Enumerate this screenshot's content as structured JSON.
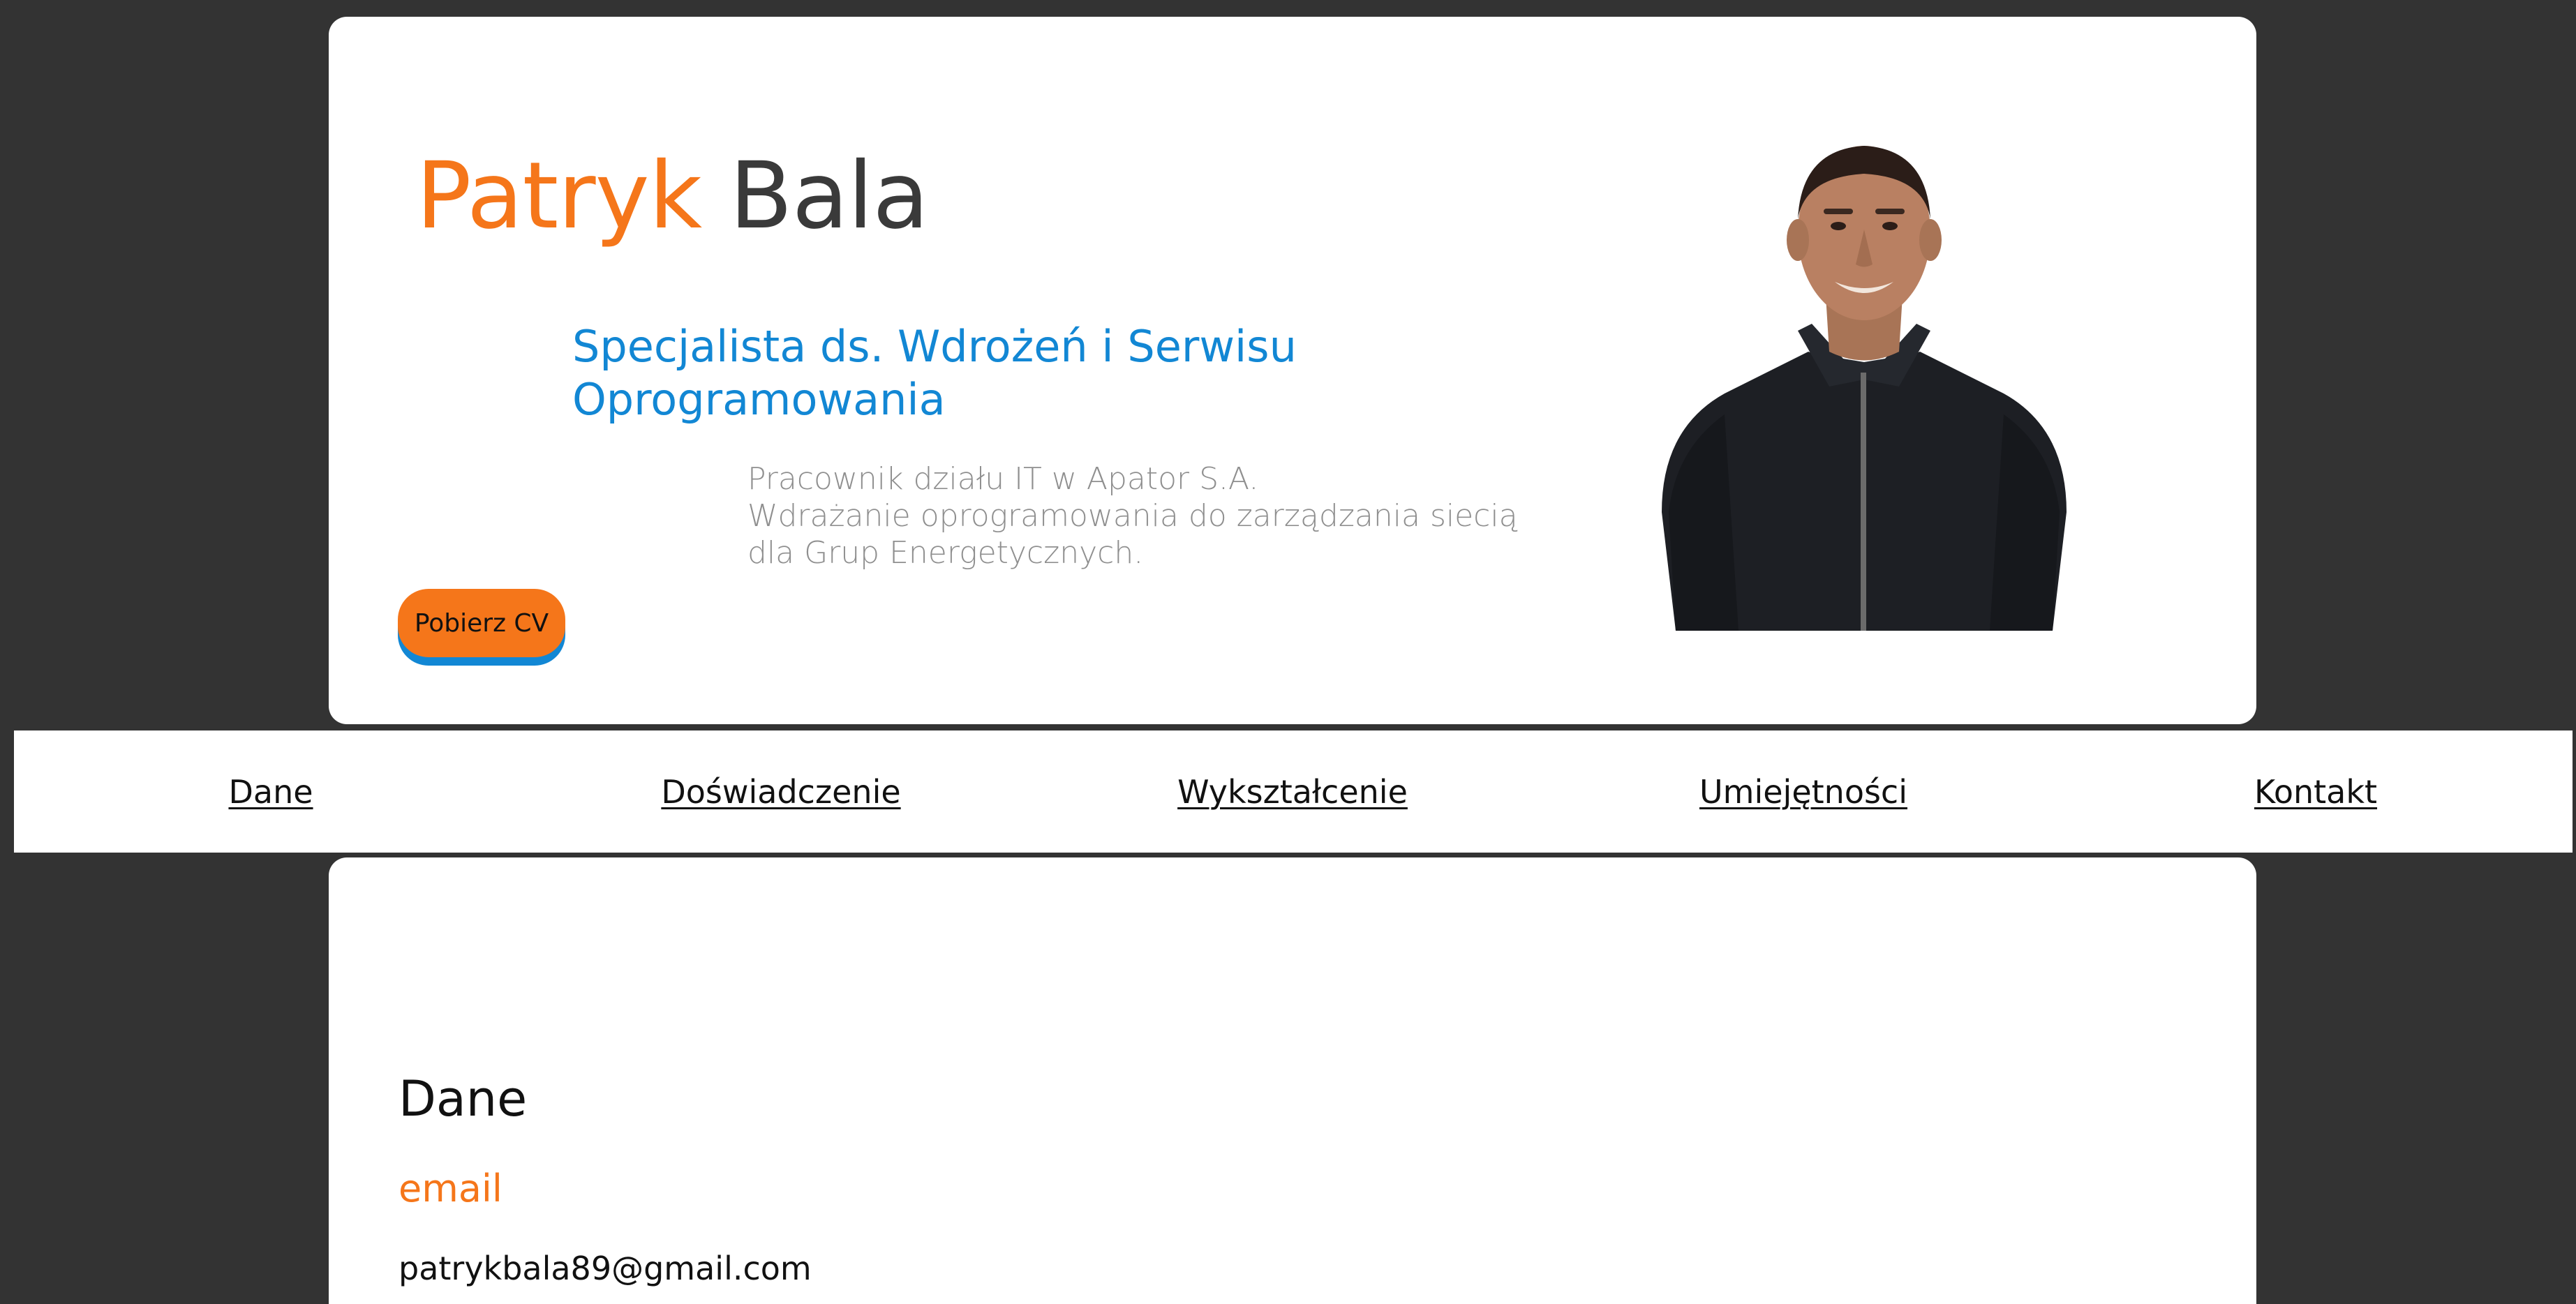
{
  "header": {
    "first_name": "Patryk",
    "last_name": "Bala",
    "job_title_line1": "Specjalista ds. Wdrożeń i Serwisu",
    "job_title_line2": "Oprogramowania",
    "description_line1": "Pracownik działu IT w Apator S.A.",
    "description_line2": "Wdrażanie oprogramowania do zarządzania siecią",
    "description_line3": "dla Grup Energetycznych.",
    "cv_button_label": "Pobierz CV"
  },
  "nav": {
    "items": [
      {
        "label": "Dane"
      },
      {
        "label": "Doświadczenie"
      },
      {
        "label": "Wykształcenie"
      },
      {
        "label": "Umiejętności"
      },
      {
        "label": "Kontakt"
      }
    ]
  },
  "main": {
    "section_title": "Dane",
    "email_label": "email",
    "email_value": "patrykbala89@gmail.com"
  },
  "colors": {
    "background": "#333333",
    "card": "#ffffff",
    "accent_orange": "#f5761a",
    "accent_blue": "#1287d4",
    "name_dark": "#3a3a3a",
    "muted_text": "#8f8f8f"
  },
  "icons": {
    "portrait": "profile-photo"
  }
}
